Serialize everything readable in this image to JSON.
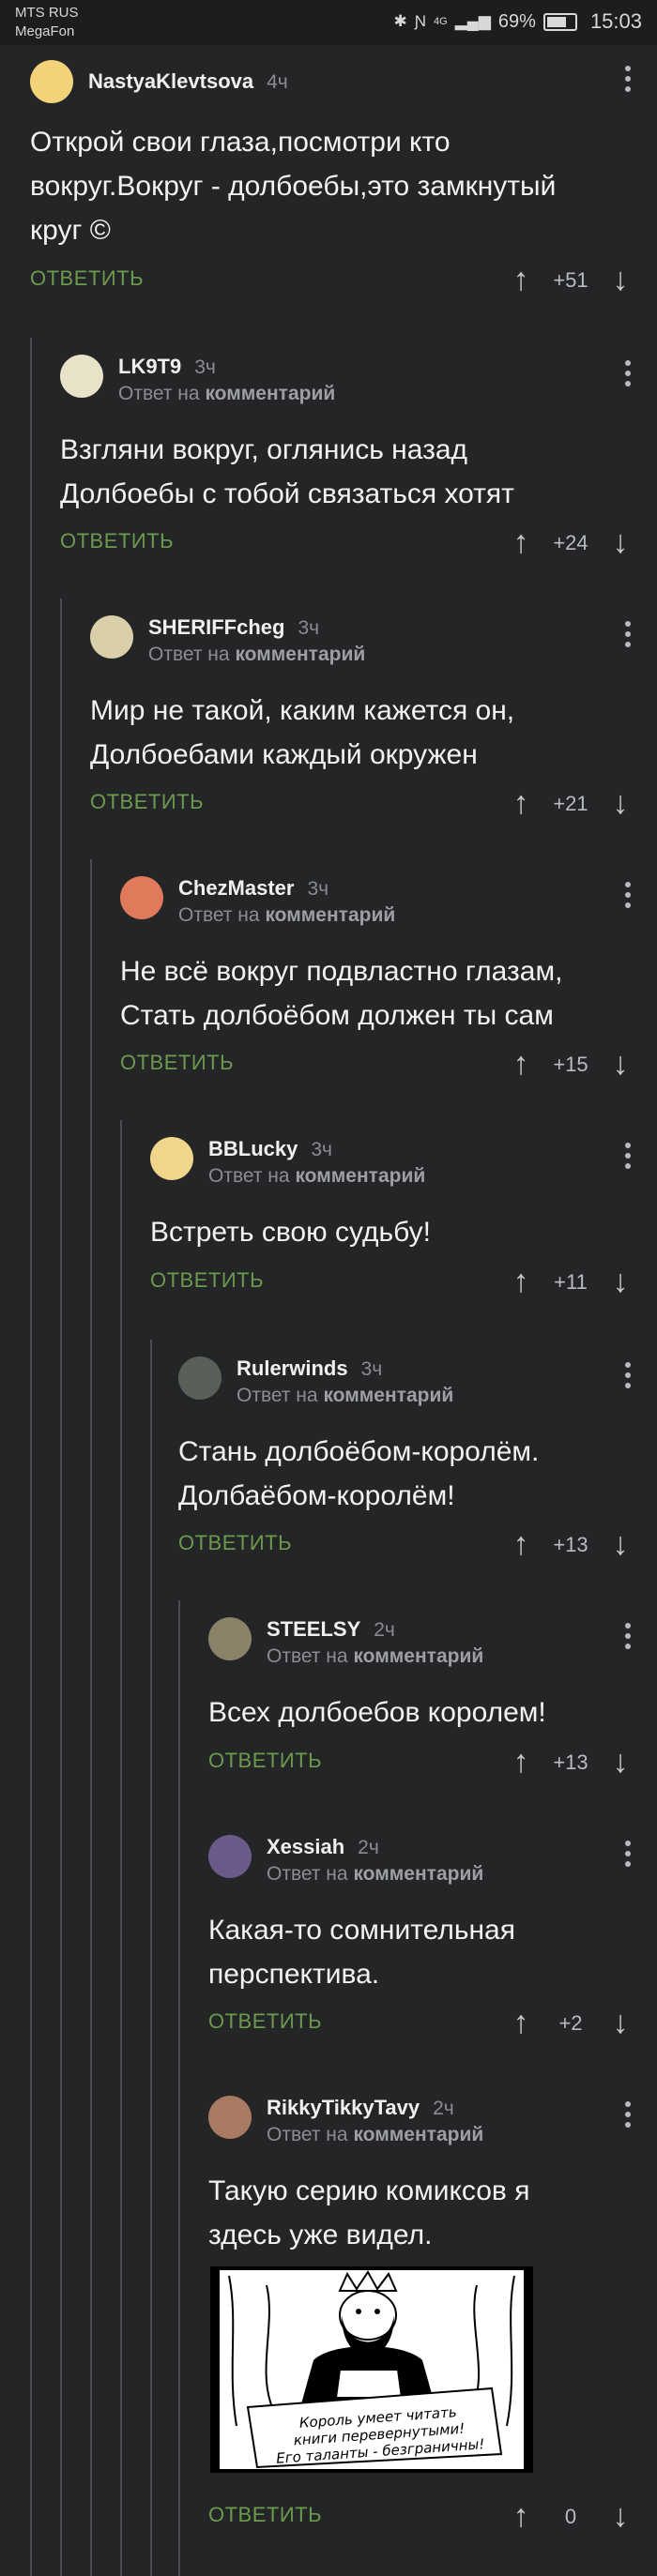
{
  "status_bar": {
    "carrier1": "MTS RUS",
    "carrier2": "MegaFon",
    "bluetooth_icon": "bluetooth-icon",
    "nfc_icon": "nfc-icon",
    "network": "4G",
    "battery": "69%",
    "time": "15:03"
  },
  "ui": {
    "answer_label": "ОТВЕТИТЬ",
    "reply_prefix": "Ответ на",
    "reply_target": "комментарий"
  },
  "comments": [
    {
      "user": "NastyaKlevtsova",
      "time": "4ч",
      "text": "Открой свои глаза,посмотри кто\nвокруг.Вокруг - долбоебы,это замкнутый\nкруг ©",
      "score": "+51",
      "avatar_color": "#f3d27a"
    },
    {
      "user": "LK9T9",
      "time": "3ч",
      "text": "Взгляни вокруг, оглянись назад\nДолбоебы с тобой связаться хотят",
      "score": "+24",
      "avatar_color": "#e8e2c8"
    },
    {
      "user": "SHERIFFcheg",
      "time": "3ч",
      "text": "Мир не такой, каким кажется он,\nДолбоебами каждый окружен",
      "score": "+21",
      "avatar_color": "#d9cfa8"
    },
    {
      "user": "ChezMaster",
      "time": "3ч",
      "text": "Не всё вокруг подвластно глазам,\nСтать долбоёбом должен ты сам",
      "score": "+15",
      "avatar_color": "#e07a5a"
    },
    {
      "user": "BBLucky",
      "time": "3ч",
      "text": "Встреть свою судьбу!",
      "score": "+11",
      "avatar_color": "#f1d58a"
    },
    {
      "user": "Rulerwinds",
      "time": "3ч",
      "text": "Стань долбоёбом-королём.\nДолбаёбом-королём!",
      "score": "+13",
      "avatar_color": "#5a5f58"
    },
    {
      "user": "STEELSY",
      "time": "2ч",
      "text": "Всех долбоебов королем!",
      "score": "+13",
      "avatar_color": "#8c826a"
    },
    {
      "user": "Xessiah",
      "time": "2ч",
      "text": "Какая-то сомнительная\nперспектива.",
      "score": "+2",
      "avatar_color": "#6a5a8a"
    },
    {
      "user": "RikkyTikkyTavy",
      "time": "2ч",
      "text": "Такую серию комиксов я\nздесь уже видел.",
      "score": "0",
      "avatar_color": "#a87a62"
    }
  ],
  "comic": {
    "caption": "Король умеет читать\nкниги перевернутыми!\nЕго таланты - безграничны!"
  }
}
